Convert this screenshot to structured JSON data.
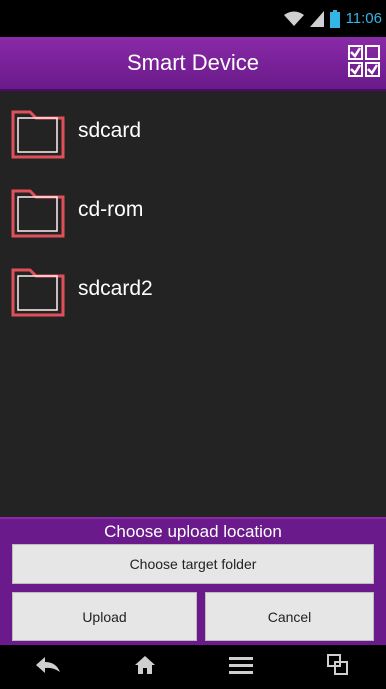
{
  "status_bar": {
    "time": "11:06",
    "icons": [
      "wifi-icon",
      "signal-icon",
      "battery-icon"
    ]
  },
  "header": {
    "title": "Smart Device",
    "select_all_icon": "checkbox-multi-icon"
  },
  "files": [
    {
      "name": "sdcard",
      "icon": "folder-icon"
    },
    {
      "name": "cd-rom",
      "icon": "folder-icon"
    },
    {
      "name": "sdcard2",
      "icon": "folder-icon"
    }
  ],
  "upload_panel": {
    "heading": "Choose upload location",
    "choose_target_label": "Choose target folder",
    "upload_label": "Upload",
    "cancel_label": "Cancel"
  },
  "nav": {
    "icons": [
      "back-icon",
      "home-icon",
      "menu-icon",
      "recent-apps-icon"
    ]
  },
  "colors": {
    "accent": "#6a1a8a",
    "status_time": "#33b5e5",
    "folder_outline": "#e0505a"
  }
}
